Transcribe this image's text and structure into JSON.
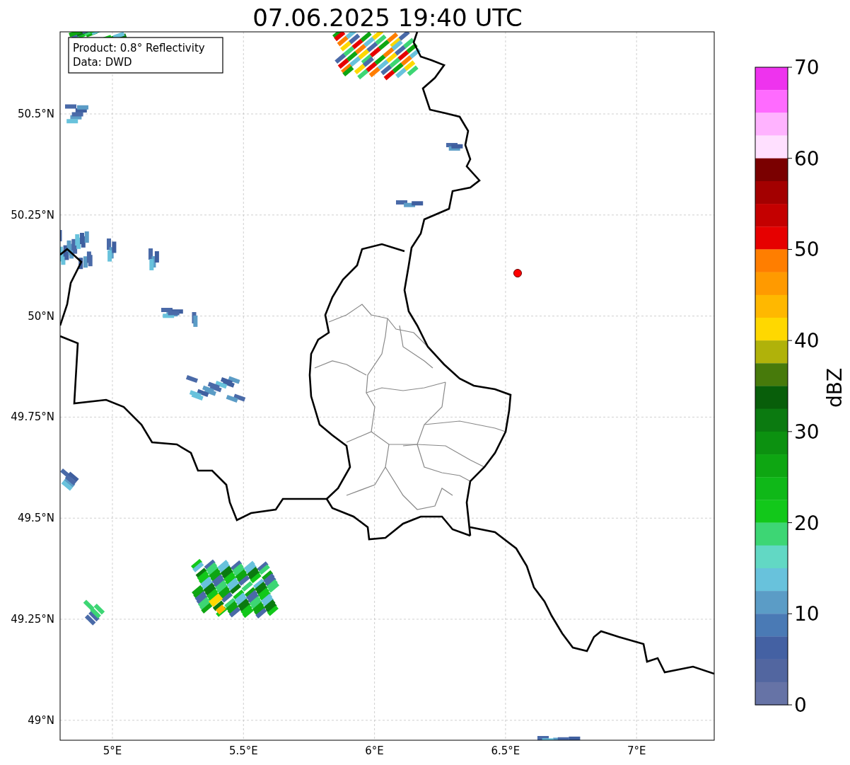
{
  "title": "07.06.2025 19:40 UTC",
  "info_box": [
    "Product: 0.8° Reflectivity",
    "Data: DWD"
  ],
  "x_ticks": [
    "5°E",
    "5.5°E",
    "6°E",
    "6.5°E",
    "7°E"
  ],
  "y_ticks": [
    "50.5°N",
    "50.25°N",
    "50°N",
    "49.75°N",
    "49.5°N",
    "49.25°N",
    "49°N"
  ],
  "colorbar": {
    "label": "dBZ",
    "ticks": [
      "70",
      "60",
      "50",
      "40",
      "30",
      "20",
      "10",
      "0"
    ],
    "segments": [
      {
        "color": "#ee33ee"
      },
      {
        "color": "#ff6bff"
      },
      {
        "color": "#ffb3ff"
      },
      {
        "color": "#ffe0ff"
      },
      {
        "color": "#7a0000"
      },
      {
        "color": "#a30000"
      },
      {
        "color": "#c40000"
      },
      {
        "color": "#e60000"
      },
      {
        "color": "#ff7e00"
      },
      {
        "color": "#ff9a00"
      },
      {
        "color": "#ffb800"
      },
      {
        "color": "#ffd800"
      },
      {
        "color": "#b0b20a"
      },
      {
        "color": "#477a0b"
      },
      {
        "color": "#085e0a"
      },
      {
        "color": "#0b7a10"
      },
      {
        "color": "#0c9110"
      },
      {
        "color": "#0ea612"
      },
      {
        "color": "#0fb818"
      },
      {
        "color": "#12c81a"
      },
      {
        "color": "#3dd674"
      },
      {
        "color": "#62d8c4"
      },
      {
        "color": "#68c2dc"
      },
      {
        "color": "#5b9cc6"
      },
      {
        "color": "#4a7ab5"
      },
      {
        "color": "#4461a3"
      },
      {
        "color": "#5266a0"
      },
      {
        "color": "#6673a6"
      }
    ]
  }
}
